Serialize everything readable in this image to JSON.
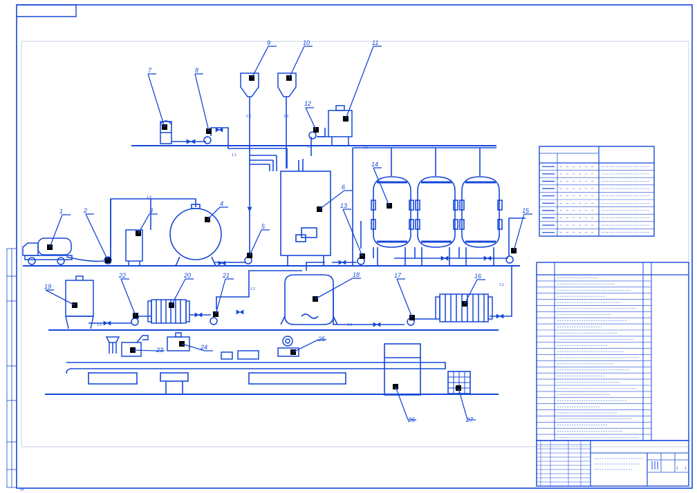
{
  "sheet": {
    "line_color": "#1446d8",
    "background": "#ffffff"
  },
  "equipment_numbers": {
    "tanker_truck": "1",
    "pump_2": "2",
    "deaerator": "3",
    "storage_tank": "4",
    "pump_5": "5",
    "mixing_tank": "6",
    "water_tank": "7",
    "pump_8": "8",
    "hopper_9": "9",
    "hopper_10": "10",
    "dosing_tank": "11",
    "pump_12": "12",
    "pump_13": "13",
    "reactor": "14",
    "pump_15": "15",
    "plate_exchanger": "16",
    "pump_17": "17",
    "buffer_tank": "18",
    "collector": "19",
    "plate_filter": "20",
    "pump_21": "21",
    "pump_22": "22",
    "filler": "23",
    "capper": "24",
    "labeler": "25",
    "cabinet": "26",
    "crate": "27"
  },
  "pipe_marks": {
    "h1": "1.1",
    "v1": "1.3",
    "v2": "1.3",
    "v3": "1.3",
    "feed": "1.3",
    "m1": "1.2",
    "m2": "1.2",
    "top": "1.1",
    "r": "1.1",
    "b": "1.5",
    "o": "1.4",
    "p": "1.4"
  },
  "legend_table": {
    "rows": 10
  },
  "equipment_list": {
    "rows": 27
  },
  "title_block": {
    "sheet_numbers": [
      "1",
      "1"
    ]
  }
}
